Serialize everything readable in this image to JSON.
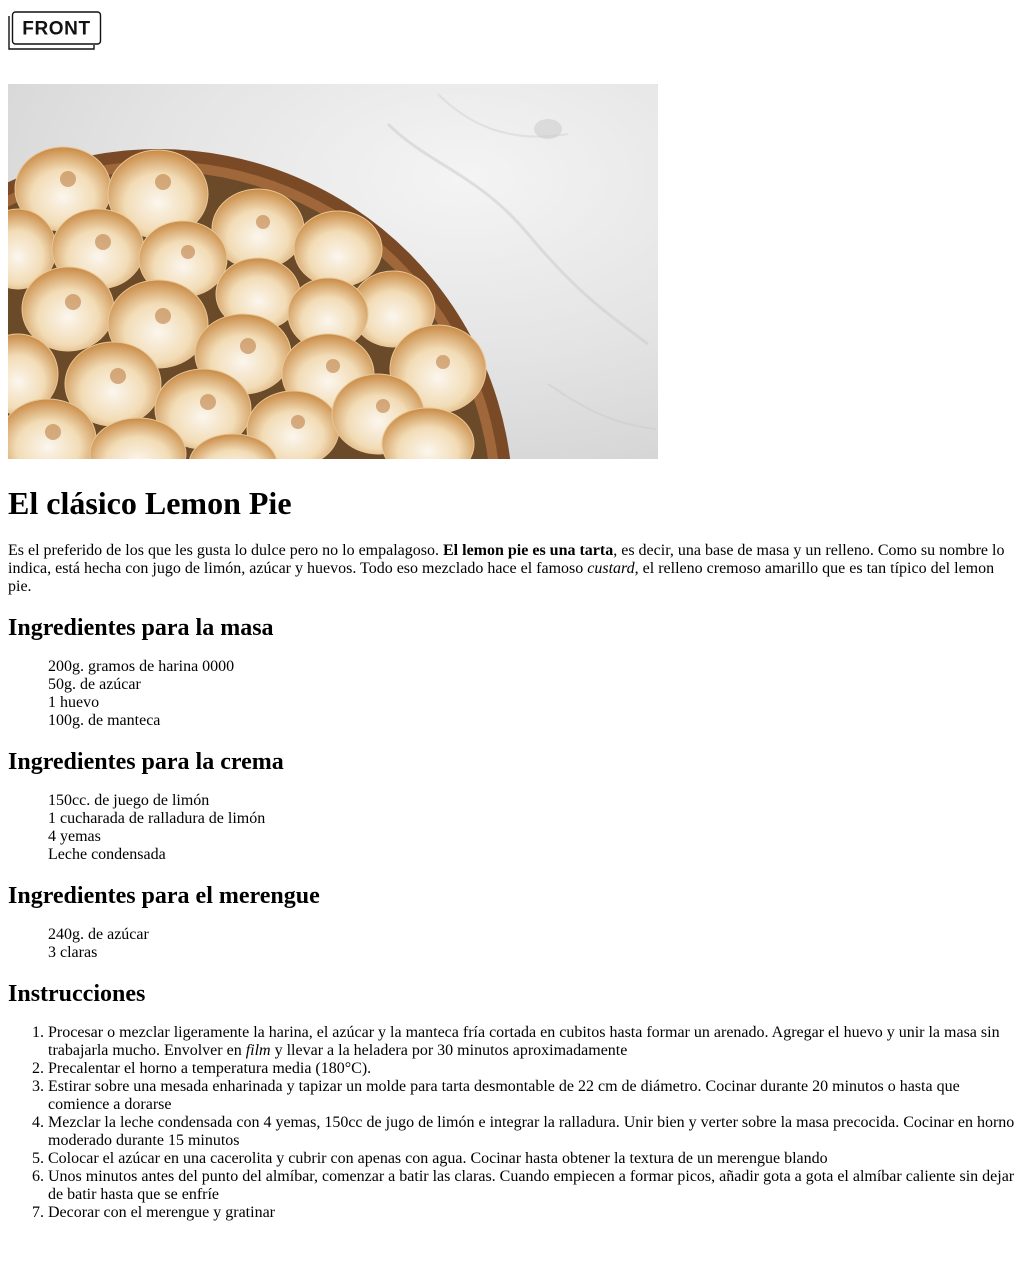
{
  "header": {
    "logo_text": "FRONT",
    "logo_icon": "front-logo-icon"
  },
  "hero": {
    "image": "lemon-pie-meringue-photo"
  },
  "article": {
    "title": "El clásico Lemon Pie",
    "intro": {
      "part1": "Es el preferido de los que les gusta lo dulce pero no lo empalagoso. ",
      "bold": "El lemon pie es una tarta",
      "part2": ", es decir, una base de masa y un relleno. Como su nombre lo indica, está hecha con jugo de limón, azúcar y huevos. Todo eso mezclado hace el famoso ",
      "italic": "custard",
      "part3": ", el relleno cremoso amarillo que es tan típico del lemon pie."
    },
    "sections": [
      {
        "heading": "Ingredientes para la masa",
        "items": [
          "200g. gramos de harina 0000",
          "50g. de azúcar",
          "1 huevo",
          "100g. de manteca"
        ]
      },
      {
        "heading": "Ingredientes para la crema",
        "items": [
          "150cc. de juego de limón",
          "1 cucharada de ralladura de limón",
          "4 yemas",
          "Leche condensada"
        ]
      },
      {
        "heading": "Ingredientes para el merengue",
        "items": [
          "240g. de azúcar",
          "3 claras"
        ]
      }
    ],
    "instructions": {
      "heading": "Instrucciones",
      "step1": {
        "before": "Procesar o mezclar ligeramente la harina, el azúcar y la manteca fría cortada en cubitos hasta formar un arenado. Agregar el huevo y unir la masa sin trabajarla mucho. Envolver en ",
        "italic": "film",
        "after": " y llevar a la heladera por 30 minutos aproximadamente"
      },
      "steps": [
        "Precalentar el horno a temperatura media (180°C).",
        "Estirar sobre una mesada enharinada y tapizar un molde para tarta desmontable de 22 cm de diámetro. Cocinar durante 20 minutos o hasta que comience a dorarse",
        "Mezclar la leche condensada con 4 yemas, 150cc de jugo de limón e integrar la ralladura. Unir bien y verter sobre la masa precocida. Cocinar en horno moderado durante 15 minutos",
        "Colocar el azúcar en una cacerolita y cubrir con apenas con agua. Cocinar hasta obtener la textura de un merengue blando",
        "Unos minutos antes del punto del almíbar, comenzar a batir las claras. Cuando empiecen a formar picos, añadir gota a gota el almíbar caliente sin dejar de batir hasta que se enfríe",
        "Decorar con el merengue y gratinar"
      ]
    }
  }
}
